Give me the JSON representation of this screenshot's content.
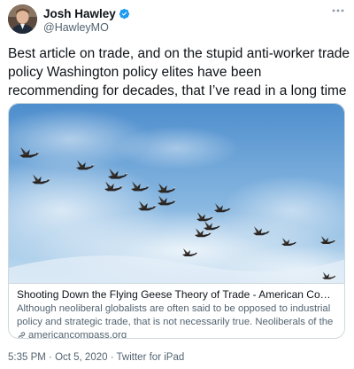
{
  "author": {
    "name": "Josh Hawley",
    "handle": "@HawleyMO"
  },
  "tweet": {
    "text": "Best article on trade, and on the stupid anti-worker trade policy Washington policy elites have been recommending for decades, that I’ve read in a long time"
  },
  "card": {
    "title": "Shooting Down the Flying Geese Theory of Trade - American Compass",
    "description": "Although neoliberal globalists are often said to be opposed to industrial policy and strategic trade, that is not necessarily true.  Neoliberals of the kind who ...",
    "domain": "americancompass.org"
  },
  "meta": {
    "time": "5:35 PM",
    "date": "Oct 5, 2020",
    "source": "Twitter for iPad",
    "separator": " · "
  },
  "colors": {
    "verified": "#1d9bf0",
    "sky_top": "#4f8fcf",
    "sky_bottom": "#bcd8ee",
    "secondary_text": "#536471"
  },
  "icons": {
    "verified": "verified-badge-icon",
    "more": "more-dots-icon",
    "link": "link-icon"
  }
}
